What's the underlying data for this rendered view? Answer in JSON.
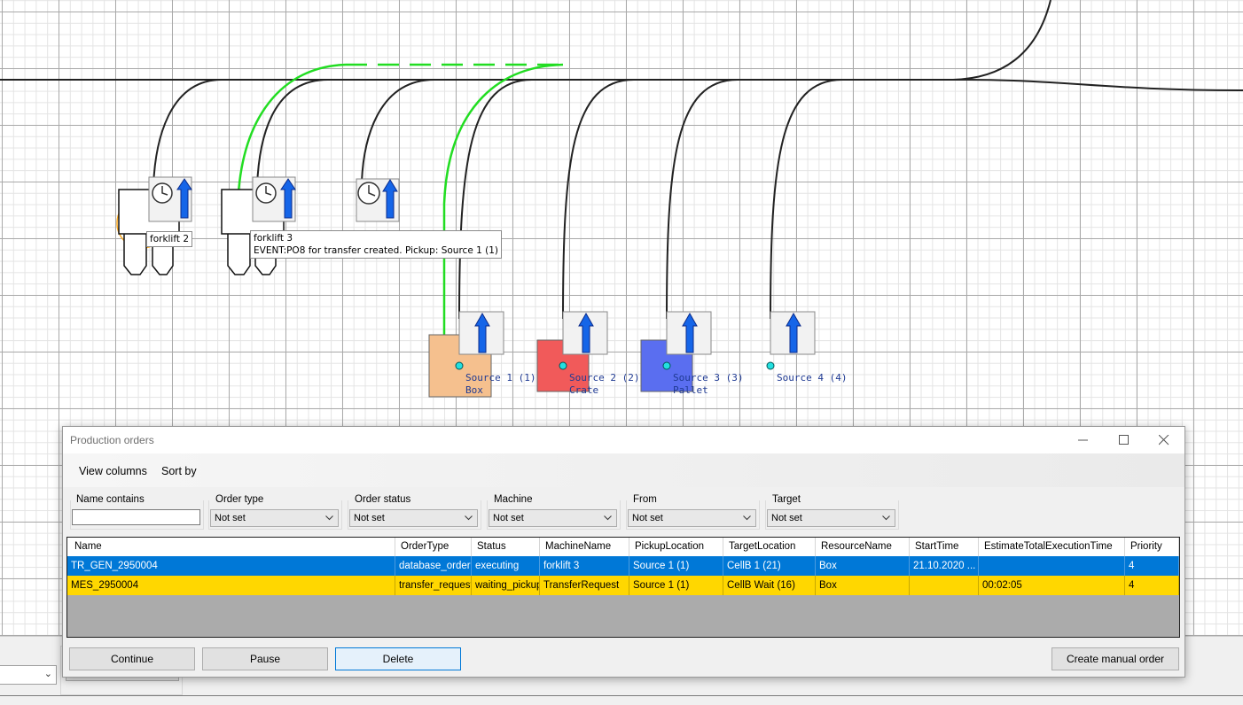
{
  "scene": {
    "forklifts": [
      {
        "label": "forklift 2"
      },
      {
        "label": "forklift 3",
        "event": "EVENT:PO8 for transfer created. Pickup: Source 1 (1)"
      }
    ],
    "sources": [
      {
        "label": "Source 1 (1)",
        "resource": "Box",
        "color": "#f5c08e"
      },
      {
        "label": "Source 2 (2)",
        "resource": "Crate",
        "color": "#f15a5a"
      },
      {
        "label": "Source 3 (3)",
        "resource": "Pallet",
        "color": "#5a6ef0"
      },
      {
        "label": "Source 4 (4)",
        "resource": ""
      }
    ],
    "colors": {
      "active_path": "#22dd22",
      "track": "#222222",
      "arrow": "#1565e8"
    }
  },
  "dialog": {
    "title": "Production orders",
    "menu": {
      "view_columns": "View columns",
      "sort_by": "Sort by"
    },
    "filters": {
      "name_contains": {
        "label": "Name contains",
        "value": ""
      },
      "order_type": {
        "label": "Order type",
        "value": "Not set"
      },
      "order_status": {
        "label": "Order status",
        "value": "Not set"
      },
      "machine": {
        "label": "Machine",
        "value": "Not set"
      },
      "from": {
        "label": "From",
        "value": "Not set"
      },
      "target": {
        "label": "Target",
        "value": "Not set"
      }
    },
    "table": {
      "columns": [
        "Name",
        "OrderType",
        "Status",
        "MachineName",
        "PickupLocation",
        "TargetLocation",
        "ResourceName",
        "StartTime",
        "EstimateTotalExecutionTime",
        "Priority"
      ],
      "rows": [
        [
          "TR_GEN_2950004",
          "database_order",
          "executing",
          "forklift 3",
          "Source 1 (1)",
          "CellB 1 (21)",
          "Box",
          "21.10.2020 ...",
          "",
          "4"
        ],
        [
          "MES_2950004",
          "transfer_request",
          "waiting_pickup",
          "TransferRequest",
          "Source 1 (1)",
          "CellB Wait (16)",
          "Box",
          "",
          "00:02:05",
          "4"
        ]
      ],
      "row_colors": {
        "selected": "#0078d7",
        "waiting": "#ffd700"
      }
    },
    "buttons": {
      "continue": "Continue",
      "pause": "Pause",
      "delete": "Delete",
      "create_manual_order": "Create manual order"
    }
  }
}
